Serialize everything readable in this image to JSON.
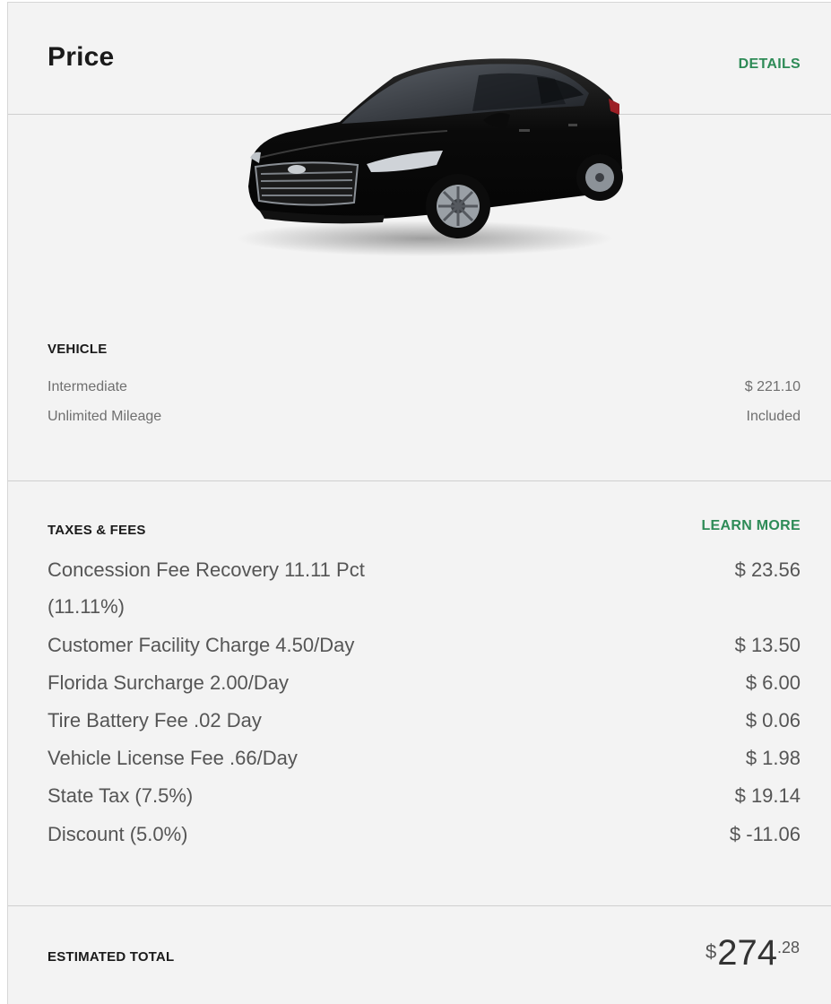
{
  "header": {
    "title": "Price",
    "details_link": "DETAILS"
  },
  "vehicle": {
    "section_label": "VEHICLE",
    "rows": [
      {
        "label": "Intermediate",
        "value": "$ 221.10"
      },
      {
        "label": "Unlimited Mileage",
        "value": "Included"
      }
    ]
  },
  "taxes": {
    "section_label": "TAXES & FEES",
    "learn_more": "LEARN MORE",
    "rows": [
      {
        "label": "Concession Fee Recovery 11.11 Pct",
        "value": "$ 23.56"
      },
      {
        "label": "(11.11%)",
        "value": ""
      },
      {
        "label": "Customer Facility Charge 4.50/Day",
        "value": "$ 13.50"
      },
      {
        "label": "Florida Surcharge 2.00/Day",
        "value": "$ 6.00"
      },
      {
        "label": "Tire Battery Fee .02 Day",
        "value": "$ 0.06"
      },
      {
        "label": "Vehicle License Fee .66/Day",
        "value": "$ 1.98"
      },
      {
        "label": "State Tax (7.5%)",
        "value": "$ 19.14"
      },
      {
        "label": "Discount (5.0%)",
        "value": "$ -11.06"
      }
    ]
  },
  "total": {
    "label": "ESTIMATED TOTAL",
    "currency": "$",
    "whole": "274",
    "cents": ".28"
  },
  "image": {
    "name": "black-sedan-car-image",
    "body_color": "#0b0b0b"
  },
  "colors": {
    "accent": "#2e8b57",
    "panel_bg": "#f3f3f3"
  }
}
